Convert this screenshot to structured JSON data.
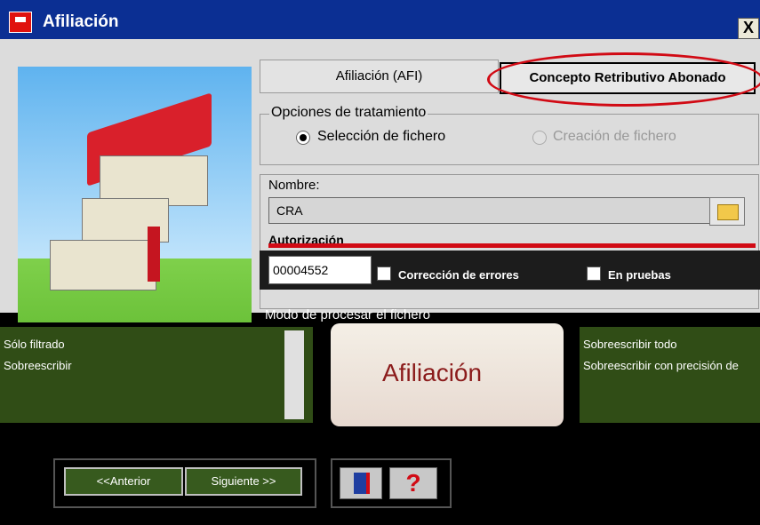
{
  "window": {
    "title": "Afiliación",
    "close_label": "X"
  },
  "tabs": {
    "afi_label": "Afiliación (AFI)",
    "cra_label": "Concepto Retributivo Abonado"
  },
  "treatment": {
    "group_label": "Opciones de tratamiento",
    "option_select_label": "Selección de fichero",
    "option_create_label": "Creación de fichero"
  },
  "file": {
    "name_label": "Nombre:",
    "name_value": "CRA",
    "auth_label": "Autorización",
    "auth_value": "00004552",
    "check_errors_label": "Corrección de errores",
    "check_test_label": "En pruebas"
  },
  "processing": {
    "group_label": "Modo de procesar el fichero",
    "list_items": [
      "Sólo filtrado",
      "Sobreescribir"
    ],
    "right_items": [
      "Sobreescribir todo",
      "Sobreescribir con precisión de"
    ],
    "banner_label": "Afiliación"
  },
  "nav": {
    "prev_label": "<<Anterior",
    "next_label": "Siguiente >>",
    "help_label": "?"
  },
  "colors": {
    "titlebar": "#0b2f93",
    "accent_red": "#d10a14"
  }
}
